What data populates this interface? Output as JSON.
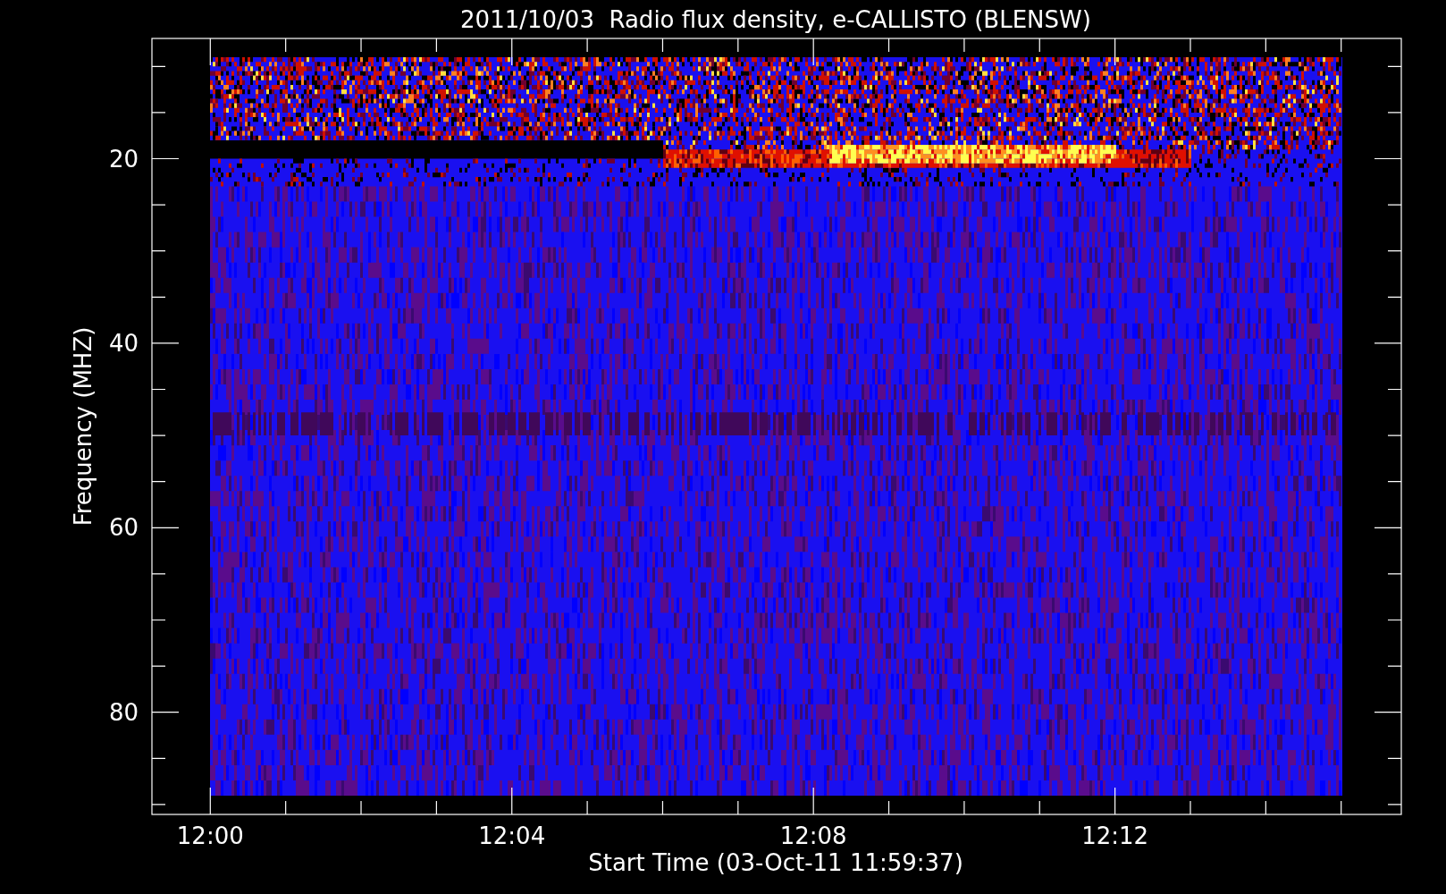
{
  "title": "2011/10/03  Radio flux density, e-CALLISTO (BLENSW)",
  "xlabel": "Start Time (03-Oct-11 11:59:37)",
  "ylabel": "Frequency (MHZ)",
  "xticks": [
    "12:00",
    "12:04",
    "12:08",
    "12:12"
  ],
  "yticks": [
    "20",
    "40",
    "60",
    "80"
  ]
}
